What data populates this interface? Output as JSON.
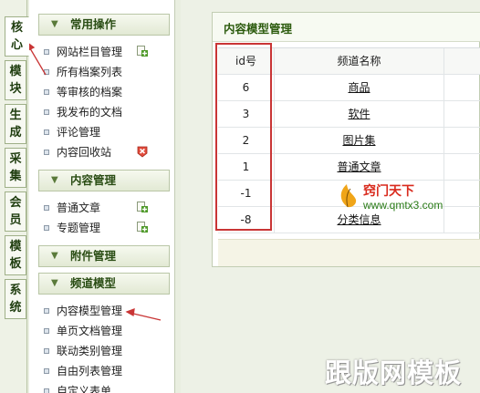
{
  "tabs": [
    {
      "label": [
        "核",
        "心"
      ],
      "active": true
    },
    {
      "label": [
        "模",
        "块"
      ],
      "active": false
    },
    {
      "label": [
        "生",
        "成"
      ],
      "active": false
    },
    {
      "label": [
        "采",
        "集"
      ],
      "active": false
    },
    {
      "label": [
        "会",
        "员"
      ],
      "active": false
    },
    {
      "label": [
        "模",
        "板"
      ],
      "active": false
    },
    {
      "label": [
        "系",
        "统"
      ],
      "active": false
    }
  ],
  "menu": {
    "common": {
      "title": "常用操作",
      "items": [
        "网站栏目管理",
        "所有档案列表",
        "等审核的档案",
        "我发布的文档",
        "评论管理",
        "内容回收站"
      ]
    },
    "content": {
      "title": "内容管理",
      "items": [
        "普通文章",
        "专题管理"
      ]
    },
    "attachment": {
      "title": "附件管理"
    },
    "channel": {
      "title": "频道模型",
      "items": [
        "内容模型管理",
        "单页文档管理",
        "联动类别管理",
        "自由列表管理",
        "自定义表单"
      ]
    }
  },
  "panel": {
    "title": "内容模型管理",
    "columns": [
      "id号",
      "频道名称"
    ],
    "rows": [
      {
        "id": "6",
        "name": "商品"
      },
      {
        "id": "3",
        "name": "软件"
      },
      {
        "id": "2",
        "name": "图片集"
      },
      {
        "id": "1",
        "name": "普通文章"
      },
      {
        "id": "-1",
        "name": ""
      },
      {
        "id": "-8",
        "name": "分类信息"
      }
    ]
  },
  "watermarks": {
    "site_name": "窍门天下",
    "site_url": "www.qmtx3.com",
    "banner": "跟版网模板"
  },
  "colors": {
    "accent_green": "#2c5b0e",
    "annotation_red": "#c93535"
  }
}
